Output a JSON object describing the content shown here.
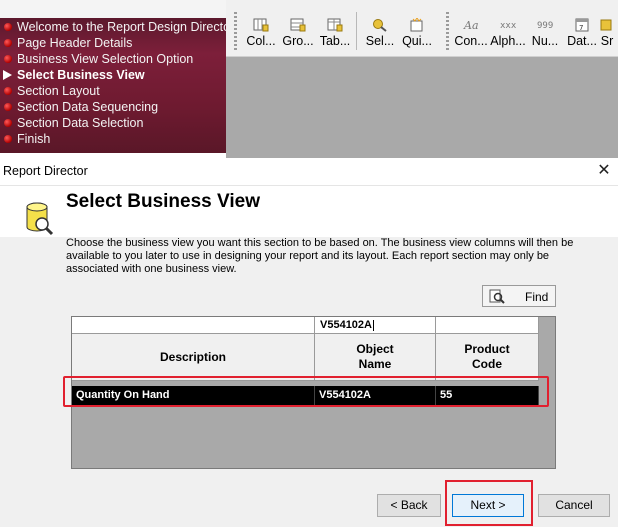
{
  "wizard_steps": [
    {
      "label": "Welcome to the Report Design Director",
      "active": false
    },
    {
      "label": "Page Header Details",
      "active": false
    },
    {
      "label": "Business View Selection Option",
      "active": false
    },
    {
      "label": "Select Business View",
      "active": true
    },
    {
      "label": "Section Layout",
      "active": false
    },
    {
      "label": "Section Data Sequencing",
      "active": false
    },
    {
      "label": "Section Data Selection",
      "active": false
    },
    {
      "label": "Finish",
      "active": false
    }
  ],
  "toolbar": {
    "col": "Col...",
    "gro": "Gro...",
    "tab": "Tab...",
    "sel": "Sel...",
    "qui": "Qui...",
    "con": "Con...",
    "alph": "Alph...",
    "nu": "Nu...",
    "dat": "Dat...",
    "sr": "Sr"
  },
  "dialog": {
    "window_title": "Report Director",
    "close_glyph": "✕",
    "heading": "Select Business View",
    "description": "Choose the business view you want this section to be based on.  The business view columns will then be available to you later to use in designing your report and its layout.  Each report section may only be associated with one business view.",
    "find_label": "Find",
    "filter_object_name": "V554102A",
    "columns": [
      {
        "label": "Description"
      },
      {
        "label": "Object Name"
      },
      {
        "label": "Product Code"
      }
    ],
    "rows": [
      {
        "description": "Quantity On Hand",
        "object_name": "V554102A",
        "product_code": "55",
        "selected": true
      }
    ],
    "buttons": {
      "back": "< Back",
      "next": "Next >",
      "cancel": "Cancel"
    }
  }
}
